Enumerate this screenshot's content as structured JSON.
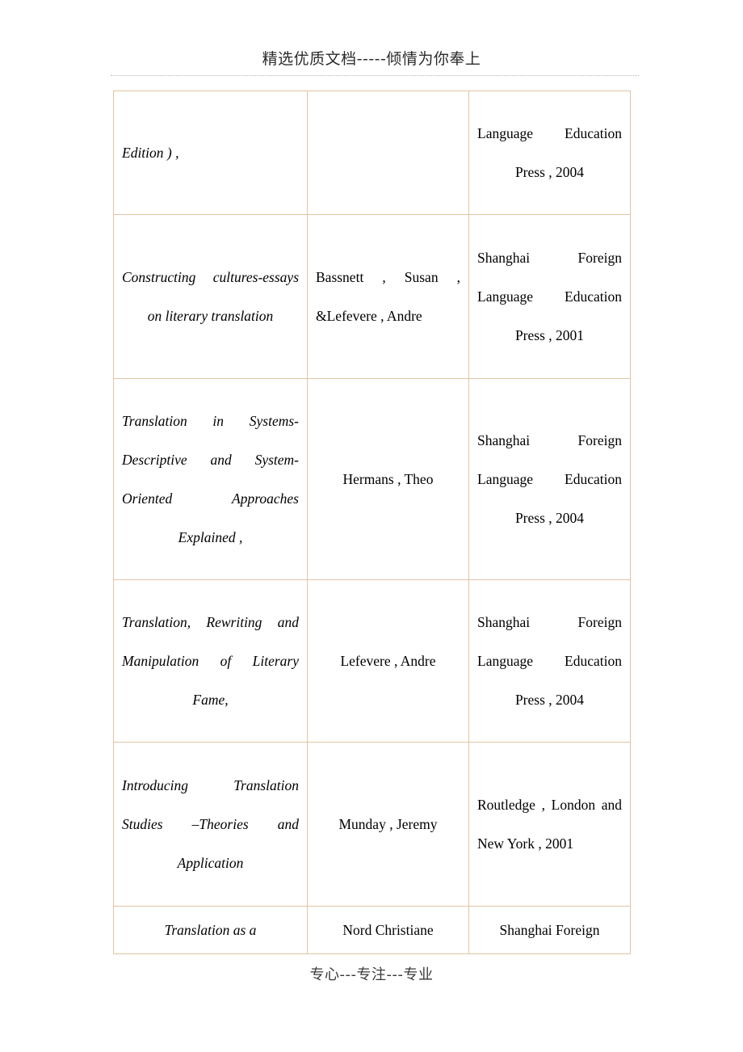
{
  "header": {
    "text": "精选优质文档-----倾情为你奉上"
  },
  "footer": {
    "text": "专心---专注---专业"
  },
  "colors": {
    "table_border": "#e3c4a2",
    "header_rule": "#b9b3c4",
    "text": "#000000",
    "page_background": "#ffffff"
  },
  "table": {
    "rows": [
      {
        "title": "Edition ) ,",
        "author": "",
        "publisher": "Language Education Press , 2004"
      },
      {
        "title": "Constructing cultures-essays on literary translation",
        "author": "Bassnett , Susan , &Lefevere , Andre",
        "publisher": "Shanghai Foreign Language Education Press , 2001"
      },
      {
        "title": "Translation in Systems-Descriptive and System-Oriented Approaches Explained ,",
        "author": "Hermans , Theo",
        "publisher": "Shanghai Foreign Language Education Press , 2004"
      },
      {
        "title": "Translation, Rewriting and Manipulation of Literary Fame,",
        "author": "Lefevere , Andre",
        "publisher": "Shanghai Foreign Language Education Press , 2004"
      },
      {
        "title": "Introducing Translation Studies –Theories and Application",
        "author": "Munday , Jeremy",
        "publisher": "Routledge , London and New York , 2001"
      },
      {
        "title": "Translation as a",
        "author": "Nord Christiane",
        "publisher": "Shanghai Foreign"
      }
    ]
  }
}
